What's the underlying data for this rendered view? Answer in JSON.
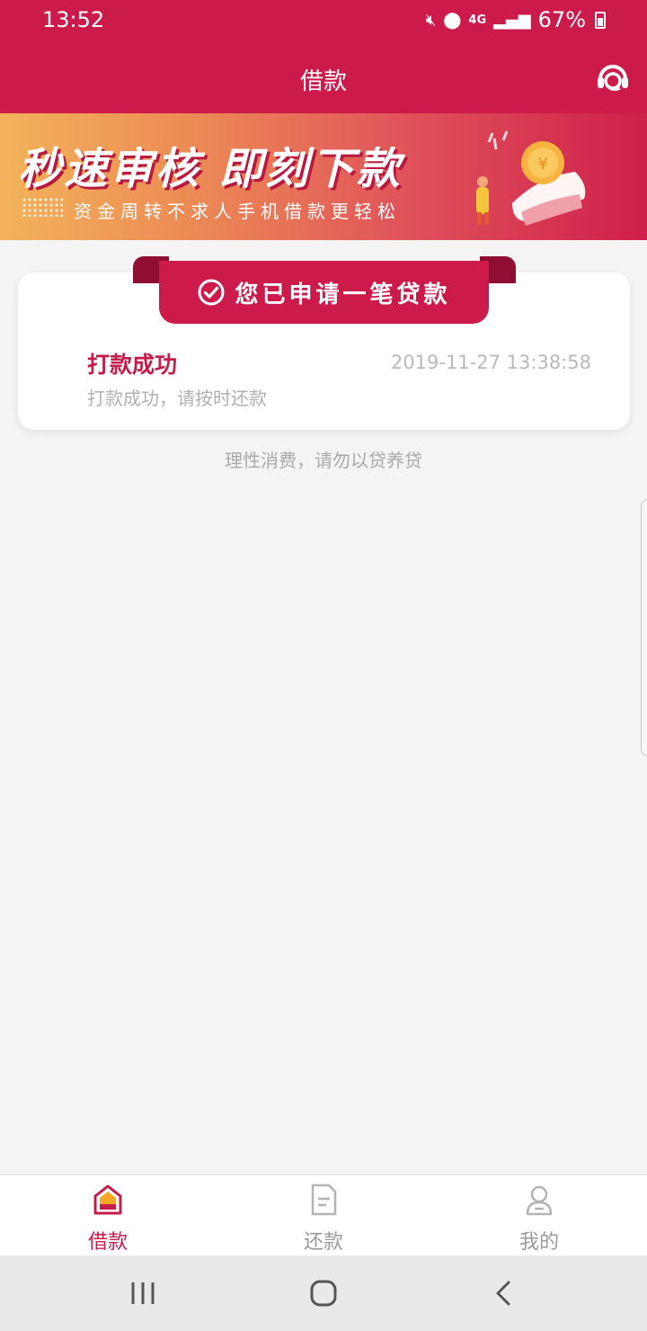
{
  "status_bar": {
    "time": "13:52",
    "signal": "4G",
    "battery": "67%"
  },
  "header": {
    "title": "借款",
    "support_icon": "headset-icon"
  },
  "banner": {
    "headline": "秒速审核 即刻下款",
    "subline": "资金周转不求人手机借款更轻松"
  },
  "application": {
    "ribbon_label": "您已申请一笔贷款",
    "status_title": "打款成功",
    "timestamp": "2019-11-27 13:38:58",
    "status_desc": "打款成功，请按时还款"
  },
  "hint": "理性消费，请勿以贷养贷",
  "tabs": [
    {
      "label": "借款",
      "icon": "house-icon",
      "active": true
    },
    {
      "label": "还款",
      "icon": "document-icon",
      "active": false
    },
    {
      "label": "我的",
      "icon": "person-icon",
      "active": false
    }
  ],
  "colors": {
    "brand": "#cc1a4b",
    "accent_text": "#c51c4a",
    "muted": "#a9a9a9"
  }
}
